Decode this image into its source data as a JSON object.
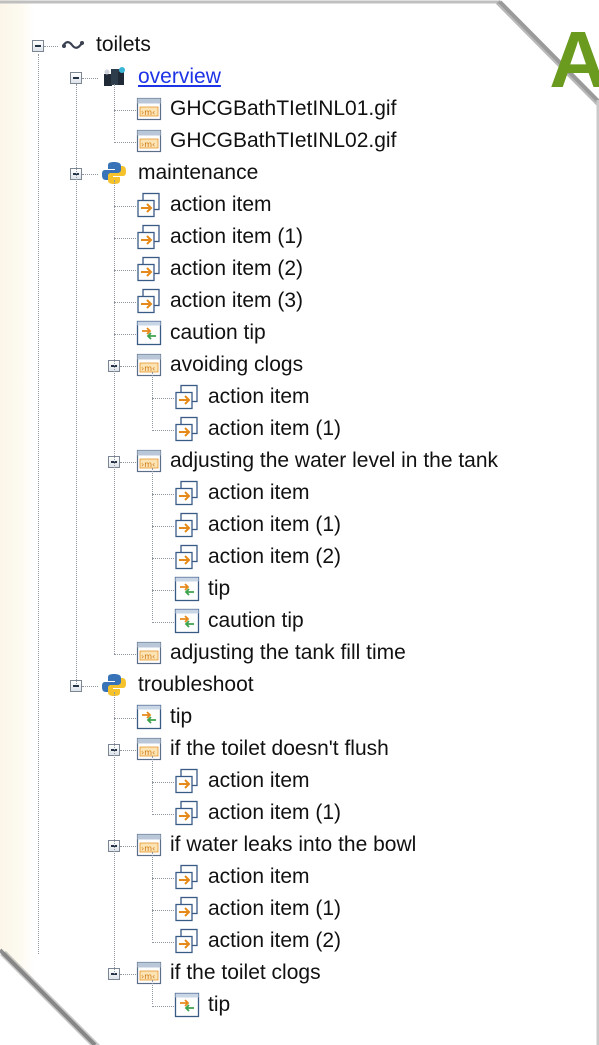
{
  "corner_text": "A",
  "tree": {
    "root": {
      "label": "toilets"
    },
    "overview": {
      "label": "overview",
      "children": [
        "GHCGBathTIetINL01.gif",
        "GHCGBathTIetINL02.gif"
      ]
    },
    "maintenance": {
      "label": "maintenance",
      "items": [
        "action item",
        "action item (1)",
        "action item (2)",
        "action item (3)",
        "caution tip"
      ],
      "avoiding_clogs": {
        "label": "avoiding clogs",
        "children": [
          "action item",
          "action item (1)"
        ]
      },
      "adjusting_water": {
        "label": "adjusting the water level in the tank",
        "children": [
          "action item",
          "action item (1)",
          "action item (2)",
          "tip",
          "caution tip"
        ]
      },
      "adjusting_fill": {
        "label": "adjusting the tank fill time"
      }
    },
    "troubleshoot": {
      "label": "troubleshoot",
      "tip": "tip",
      "no_flush": {
        "label": "if the toilet doesn't flush",
        "children": [
          "action item",
          "action item (1)"
        ]
      },
      "leaks": {
        "label": "if water leaks into the bowl",
        "children": [
          "action item",
          "action item (1)",
          "action item (2)"
        ]
      },
      "clogs": {
        "label": "if the toilet clogs",
        "children": [
          "tip"
        ]
      }
    }
  }
}
